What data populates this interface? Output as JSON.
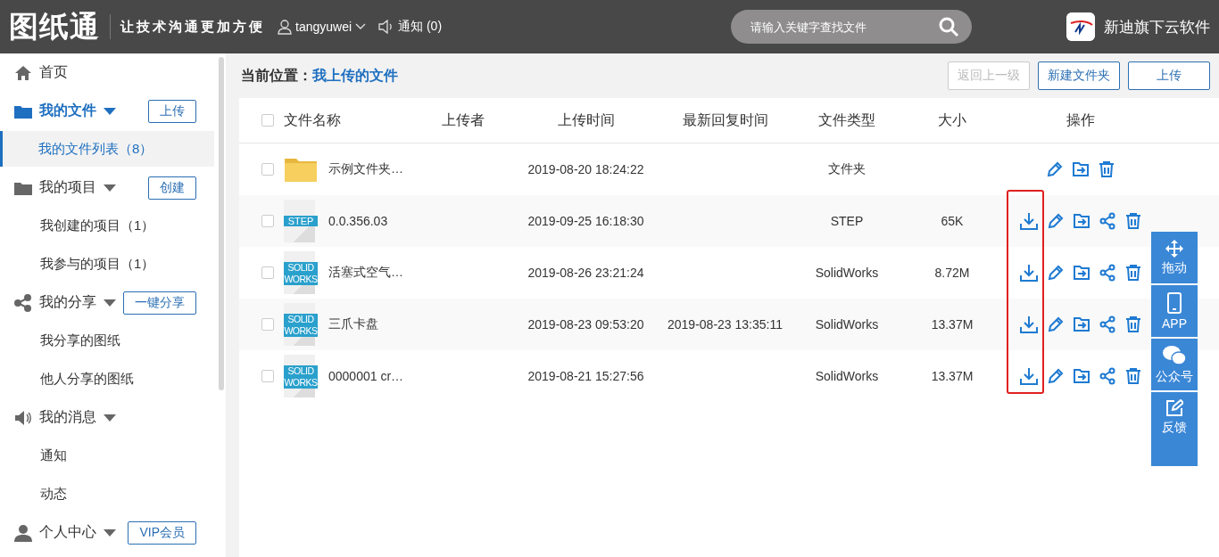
{
  "header": {
    "logo": "图纸通",
    "slogan": "让技术沟通更加方便",
    "user": "tangyuwei",
    "notice": "通知 (0)",
    "search": {
      "placeholder": "请输入关键字查找文件"
    },
    "brand": "新迪旗下云软件"
  },
  "sidebar": {
    "items": [
      {
        "kind": "link",
        "label": "首页"
      },
      {
        "kind": "section",
        "label": "我的文件",
        "active": true,
        "button": "上传",
        "children": [
          {
            "label": "我的文件列表（8）",
            "selected": true
          }
        ]
      },
      {
        "kind": "section",
        "label": "我的项目",
        "active": false,
        "button": "创建",
        "children": [
          {
            "label": "我创建的项目（1）",
            "selected": false
          },
          {
            "label": "我参与的项目（1）",
            "selected": false
          }
        ]
      },
      {
        "kind": "section",
        "label": "我的分享",
        "active": false,
        "button": "一键分享",
        "children": [
          {
            "label": "我分享的图纸",
            "selected": false
          },
          {
            "label": "他人分享的图纸",
            "selected": false
          }
        ]
      },
      {
        "kind": "section",
        "label": "我的消息",
        "active": false,
        "children": [
          {
            "label": "通知",
            "selected": false
          },
          {
            "label": "动态",
            "selected": false
          }
        ]
      },
      {
        "kind": "section",
        "label": "个人中心",
        "active": false,
        "button": "VIP会员"
      }
    ]
  },
  "breadcrumb": {
    "label": "当前位置：",
    "current": "我上传的文件"
  },
  "toolbar": [
    {
      "label": "返回上一级",
      "disabled": true
    },
    {
      "label": "新建文件夹",
      "disabled": false
    },
    {
      "label": "上传",
      "disabled": false
    }
  ],
  "table": {
    "checked": false,
    "columns": [
      "文件名称",
      "上传者",
      "上传时间",
      "最新回复时间",
      "文件类型",
      "大小",
      "操作"
    ],
    "rows": [
      {
        "kind": "folder",
        "checked": false,
        "name": "示例文件夹…",
        "uploaded": "2019-08-20 18:24:22",
        "type": "文件夹",
        "actions": [
          {
            "kind": "edit"
          },
          {
            "kind": "move"
          },
          {
            "kind": "delete"
          }
        ]
      },
      {
        "kind": "step",
        "thumb": "STEP",
        "checked": false,
        "name": "0.0.356.03",
        "uploaded": "2019-09-25 16:18:30",
        "type": "STEP",
        "size": "65K",
        "actions": [
          {
            "kind": "download"
          },
          {
            "kind": "edit"
          },
          {
            "kind": "move"
          },
          {
            "kind": "share"
          },
          {
            "kind": "delete"
          }
        ]
      },
      {
        "kind": "solidworks",
        "thumb": "SOLID WORKS",
        "checked": false,
        "name": "活塞式空气…",
        "uploaded": "2019-08-26 23:21:24",
        "type": "SolidWorks",
        "size": "8.72M",
        "actions": [
          {
            "kind": "download"
          },
          {
            "kind": "edit"
          },
          {
            "kind": "move"
          },
          {
            "kind": "share"
          },
          {
            "kind": "delete"
          }
        ]
      },
      {
        "kind": "solidworks",
        "thumb": "SOLID WORKS",
        "checked": false,
        "name": "三爪卡盘",
        "uploaded": "2019-08-23 09:53:20",
        "replied": "2019-08-23 13:35:11",
        "type": "SolidWorks",
        "size": "13.37M",
        "actions": [
          {
            "kind": "download"
          },
          {
            "kind": "edit"
          },
          {
            "kind": "move"
          },
          {
            "kind": "share"
          },
          {
            "kind": "delete"
          }
        ]
      },
      {
        "kind": "solidworks",
        "thumb": "SOLID WORKS",
        "checked": false,
        "name": "0000001 cr…",
        "uploaded": "2019-08-21 15:27:56",
        "type": "SolidWorks",
        "size": "13.37M",
        "actions": [
          {
            "kind": "download"
          },
          {
            "kind": "edit"
          },
          {
            "kind": "move"
          },
          {
            "kind": "share"
          },
          {
            "kind": "delete"
          }
        ]
      }
    ]
  },
  "float_bar": [
    {
      "kind": "drag",
      "label": "拖动"
    },
    {
      "kind": "app",
      "label": "APP"
    },
    {
      "kind": "wechat",
      "label": "公众号"
    },
    {
      "kind": "feedback",
      "label": "反馈"
    }
  ]
}
